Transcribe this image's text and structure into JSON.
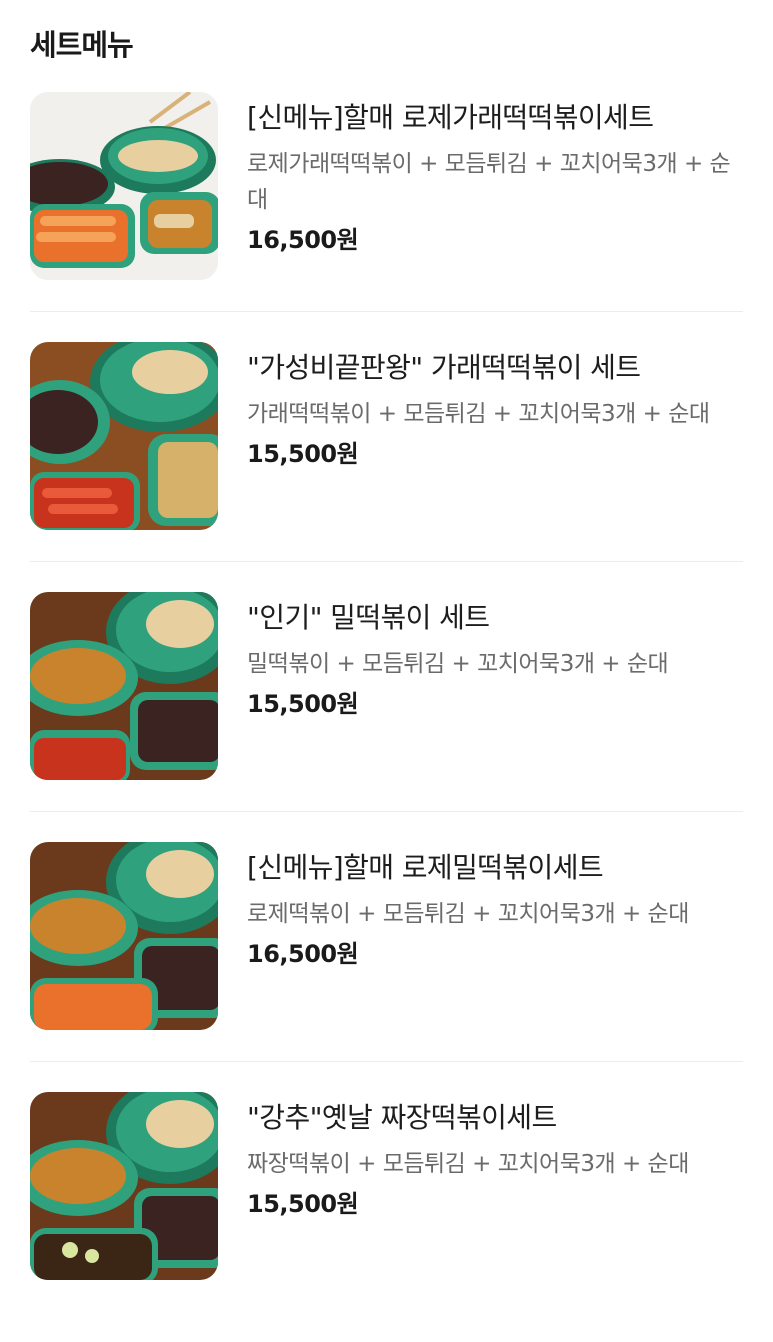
{
  "section": {
    "title": "세트메뉴"
  },
  "items": [
    {
      "name": "[신메뉴]할매 로제가래떡떡볶이세트",
      "desc": "로제가래떡떡볶이 + 모듬튀김 + 꼬치어묵3개 + 순대",
      "price": "16,500원",
      "image_icon": "food-photo-icon"
    },
    {
      "name": "\"가성비끝판왕\" 가래떡떡볶이 세트",
      "desc": "가래떡떡볶이 + 모듬튀김 + 꼬치어묵3개 + 순대",
      "price": "15,500원",
      "image_icon": "food-photo-icon"
    },
    {
      "name": "\"인기\" 밀떡볶이 세트",
      "desc": "밀떡볶이 + 모듬튀김 + 꼬치어묵3개 + 순대",
      "price": "15,500원",
      "image_icon": "food-photo-icon"
    },
    {
      "name": "[신메뉴]할매 로제밀떡볶이세트",
      "desc": "로제떡볶이 + 모듬튀김 + 꼬치어묵3개 + 순대",
      "price": "16,500원",
      "image_icon": "food-photo-icon"
    },
    {
      "name": "\"강추\"옛날 짜장떡볶이세트",
      "desc": "짜장떡볶이 + 모듬튀김 + 꼬치어묵3개 + 순대",
      "price": "15,500원",
      "image_icon": "food-photo-icon"
    }
  ],
  "colors": {
    "plate": "#2fa27d",
    "plate_dark": "#1d7a5c",
    "rose_sauce": "#e9712c",
    "red_sauce": "#c8331d",
    "fried": "#c9832d",
    "fishcake": "#e8cfa0",
    "sundae": "#3a2320",
    "jjajang": "#3b2616",
    "wood": "#8a4e22"
  }
}
